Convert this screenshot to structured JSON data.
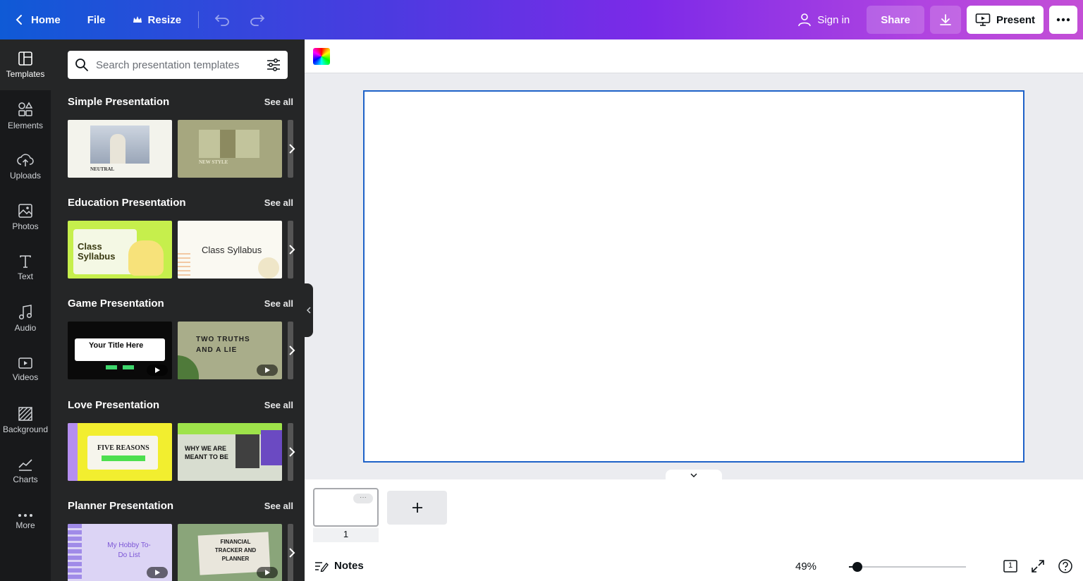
{
  "header": {
    "home_label": "Home",
    "file_label": "File",
    "resize_label": "Resize",
    "signin_label": "Sign in",
    "share_label": "Share",
    "present_label": "Present"
  },
  "rail": {
    "items": [
      {
        "label": "Templates",
        "icon": "templates-icon"
      },
      {
        "label": "Elements",
        "icon": "elements-icon"
      },
      {
        "label": "Uploads",
        "icon": "upload-icon"
      },
      {
        "label": "Photos",
        "icon": "photo-icon"
      },
      {
        "label": "Text",
        "icon": "text-icon"
      },
      {
        "label": "Audio",
        "icon": "music-icon"
      },
      {
        "label": "Videos",
        "icon": "video-icon"
      },
      {
        "label": "Background",
        "icon": "background-icon"
      },
      {
        "label": "Charts",
        "icon": "chart-icon"
      },
      {
        "label": "More",
        "icon": "more-icon"
      }
    ]
  },
  "panel": {
    "search_placeholder": "Search presentation templates",
    "see_all_label": "See all",
    "sections": [
      {
        "title": "Simple Presentation",
        "thumb1": "NEUTRAL",
        "thumb2": "NEW STYLE"
      },
      {
        "title": "Education Presentation",
        "thumb1": "Class Syllabus",
        "thumb2": "Class Syllabus"
      },
      {
        "title": "Game Presentation",
        "thumb1": "Your Title Here",
        "thumb2": "TWO TRUTHS AND A LIE"
      },
      {
        "title": "Love Presentation",
        "thumb1": "FIVE REASONS",
        "thumb2": "WHY WE ARE MEANT TO BE"
      },
      {
        "title": "Planner Presentation",
        "thumb1": "My Hobby To-Do List",
        "thumb2": "FINANCIAL TRACKER AND PLANNER"
      }
    ]
  },
  "pages": {
    "current_page_number": "1"
  },
  "footer": {
    "notes_label": "Notes",
    "zoom_label": "49%",
    "zoom_fraction": 0.07,
    "page_count": "1"
  },
  "colors": {
    "accent_blue": "#1e62c8",
    "dark_panel": "#252627",
    "rail": "#18191b"
  }
}
